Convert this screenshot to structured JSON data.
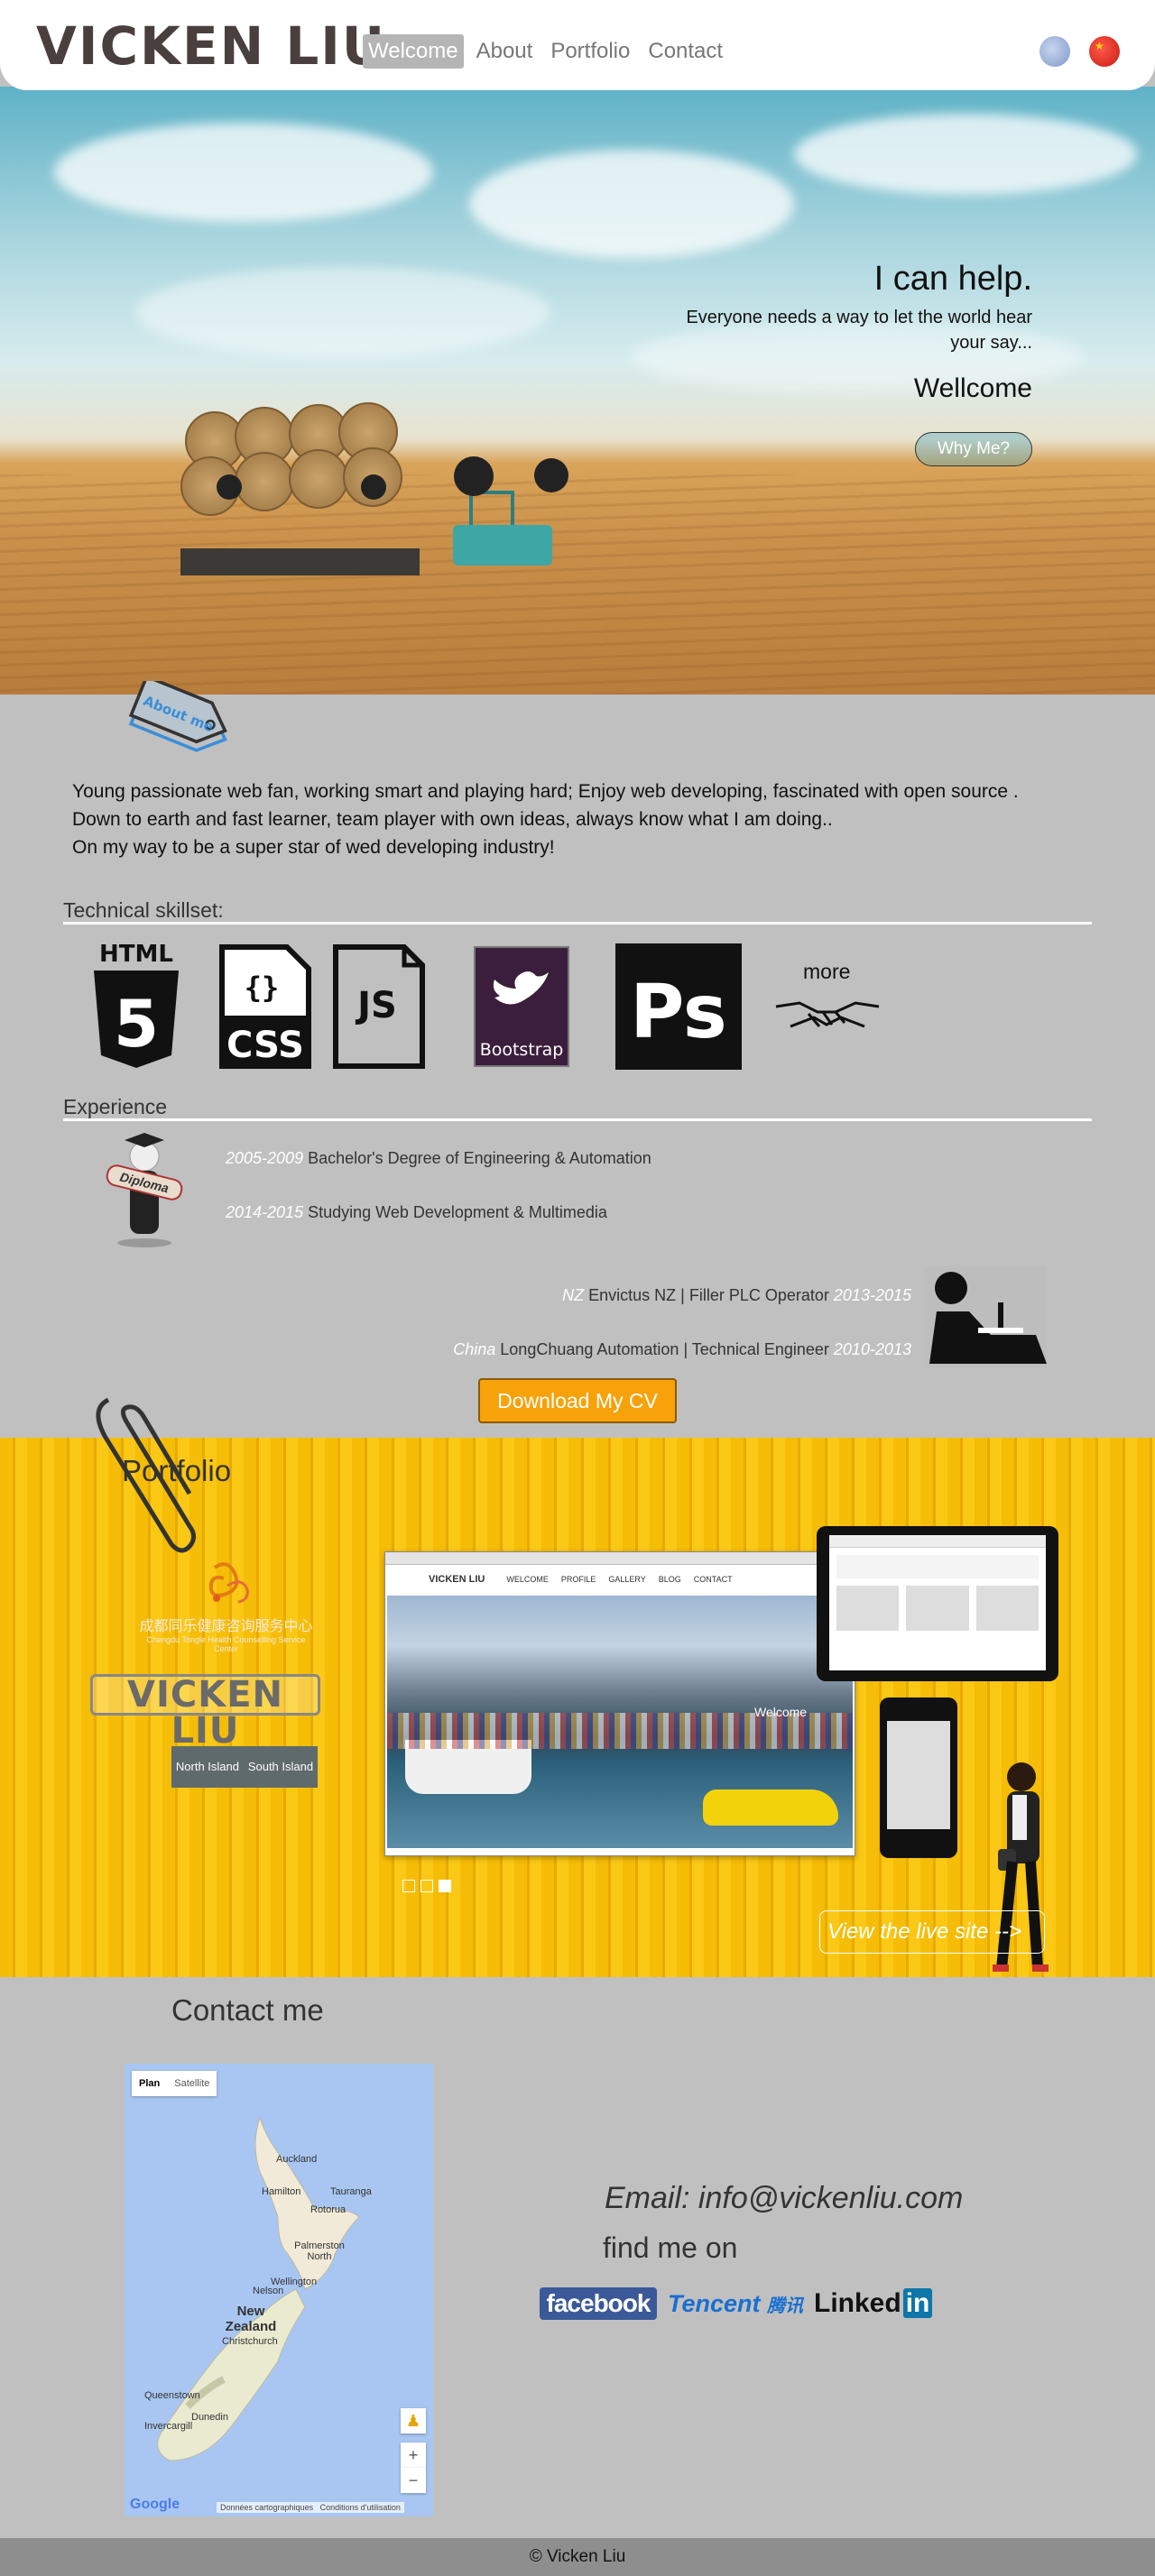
{
  "header": {
    "logo": "VICKEN LIU",
    "nav": [
      "Welcome",
      "About",
      "Portfolio",
      "Contact"
    ],
    "active_nav": "Welcome",
    "languages": [
      "nz-flag-icon",
      "china-flag-icon"
    ]
  },
  "hero": {
    "title": "I can help.",
    "subtitle": "Everyone needs a way to let the world hear your say...",
    "welcome": "Wellcome",
    "button": "Why Me?"
  },
  "about": {
    "tag": "About me",
    "lines": [
      "Young passionate web fan, working smart and playing hard; Enjoy web developing, fascinated with open source .",
      "Down to earth and fast learner, team player with own ideas, always know what I am doing..",
      "On my way to be a super star of wed developing industry!"
    ]
  },
  "skills": {
    "title": "Technical skillset:",
    "items": [
      "HTML",
      "CSS",
      "JS",
      "Bootstrap",
      "Ps"
    ],
    "html_badge": "5",
    "more": "more"
  },
  "experience": {
    "title": "Experience",
    "education": [
      {
        "years": "2005-2009",
        "text": "Bachelor's Degree of Engineering & Automation"
      },
      {
        "years": "2014-2015",
        "text": "Studying Web Development & Multimedia"
      }
    ],
    "diploma_label": "Diploma",
    "work": [
      {
        "place": "NZ",
        "text": "Envictus NZ | Filler PLC Operator",
        "years": "2013-2015"
      },
      {
        "place": "China",
        "text": "LongChuang Automation | Technical Engineer",
        "years": "2010-2013"
      }
    ],
    "download": "Download My CV"
  },
  "portfolio": {
    "title": "Portfolio",
    "thumb_cn_title": "成都同乐健康咨询服务中心",
    "thumb_cn_sub": "Chengdu Tongle Health Counselling Service Center",
    "thumb_vl": "VICKEN LIU",
    "thumb_map": [
      "North Island",
      "South Island"
    ],
    "preview": {
      "logo": "VICKEN LIU",
      "nav": [
        "WELCOME",
        "PROFILE",
        "GALLERY",
        "BLOG",
        "CONTACT"
      ],
      "caption": "Welcome"
    },
    "live_button": "View the live site -->"
  },
  "contact": {
    "title": "Contact me",
    "map": {
      "tabs": [
        "Plan",
        "Satellite"
      ],
      "labels": [
        "Auckland",
        "Hamilton",
        "Tauranga",
        "Rotorua",
        "Palmerston North",
        "Nelson",
        "Wellington",
        "New Zealand",
        "Christchurch",
        "Queenstown",
        "Dunedin",
        "Invercargill"
      ],
      "google": "Google",
      "footer": [
        "Données cartographiques",
        "Conditions d'utilisation"
      ]
    },
    "email": "Email: info@vickenliu.com",
    "find_me": "find me on",
    "social": {
      "facebook": "facebook",
      "tencent_latin": "Tencent",
      "tencent_cn": "腾讯",
      "linkedin": "Linked",
      "linkedin_in": "in"
    }
  },
  "footer": "© Vicken Liu"
}
